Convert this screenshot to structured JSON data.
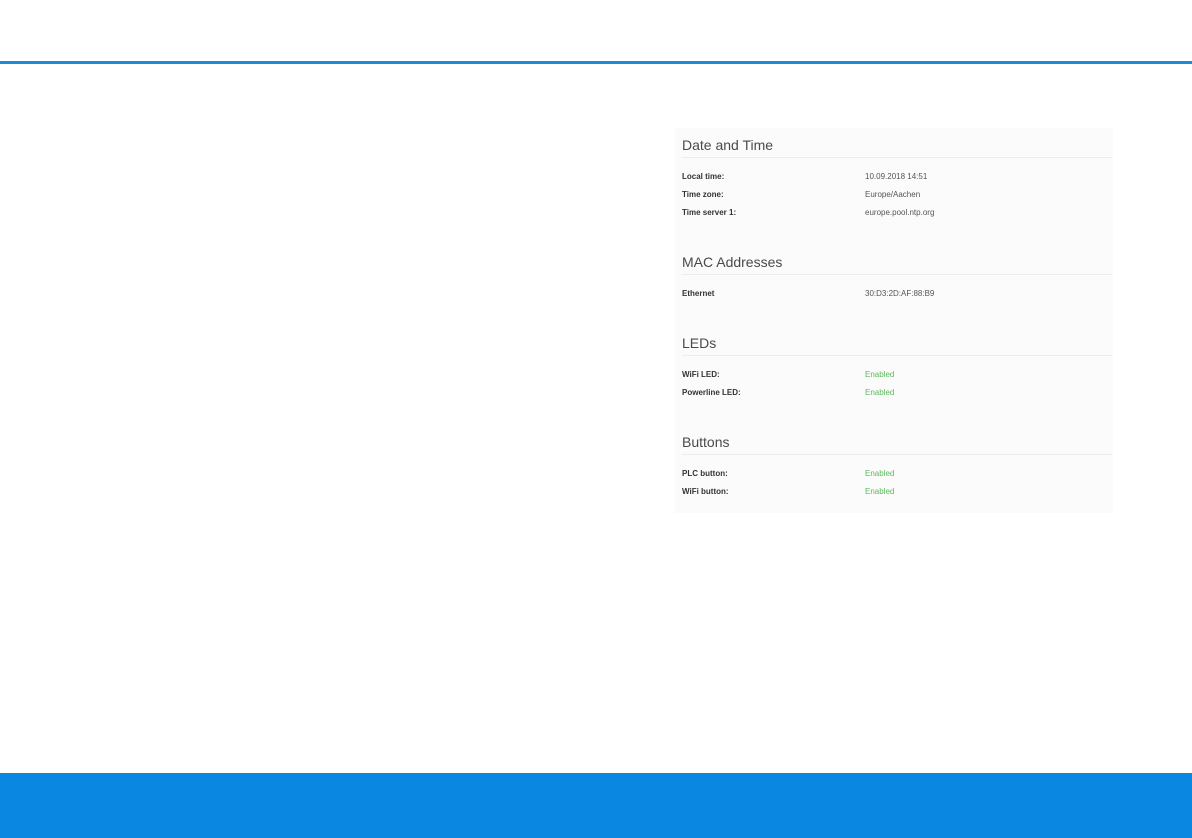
{
  "date_time": {
    "title": "Date and Time",
    "rows": [
      {
        "label": "Local time:",
        "value": "10.09.2018 14:51"
      },
      {
        "label": "Time zone:",
        "value": "Europe/Aachen"
      },
      {
        "label": "Time server 1:",
        "value": "europe.pool.ntp.org"
      }
    ]
  },
  "mac_addresses": {
    "title": "MAC Addresses",
    "rows": [
      {
        "label": "Ethernet",
        "value": "30:D3:2D:AF:88:B9"
      }
    ]
  },
  "leds": {
    "title": "LEDs",
    "rows": [
      {
        "label": "WiFi LED:",
        "value": "Enabled"
      },
      {
        "label": "Powerline LED:",
        "value": "Enabled"
      }
    ]
  },
  "buttons": {
    "title": "Buttons",
    "rows": [
      {
        "label": "PLC button:",
        "value": "Enabled"
      },
      {
        "label": "WiFi button:",
        "value": "Enabled"
      }
    ]
  },
  "colors": {
    "accent_line": "#1a8bd6",
    "footer_bar": "#0a87e0",
    "enabled_status": "#5cb85c"
  }
}
